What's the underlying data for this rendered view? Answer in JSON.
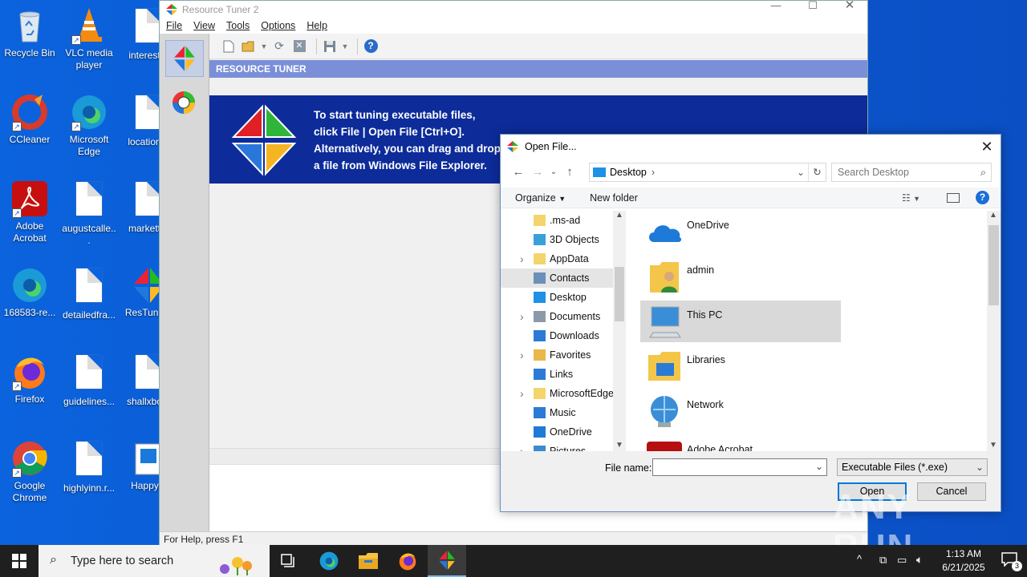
{
  "desktop": {
    "icons": [
      {
        "label": "Recycle Bin"
      },
      {
        "label": "VLC media player"
      },
      {
        "label": "interest..."
      },
      {
        "label": "CCleaner"
      },
      {
        "label": "Microsoft Edge"
      },
      {
        "label": "location..."
      },
      {
        "label": "Adobe Acrobat"
      },
      {
        "label": "augustcalle..."
      },
      {
        "label": "markett..."
      },
      {
        "label": "168583-re..."
      },
      {
        "label": "detailedfra..."
      },
      {
        "label": "ResTune..."
      },
      {
        "label": "Firefox"
      },
      {
        "label": "guidelines..."
      },
      {
        "label": "shallxbo..."
      },
      {
        "label": "Google Chrome"
      },
      {
        "label": "highlyinn.r..."
      },
      {
        "label": "Happy..."
      }
    ]
  },
  "app": {
    "title": "Resource Tuner 2",
    "menu": [
      "File",
      "View",
      "Tools",
      "Options",
      "Help"
    ],
    "banner_header": "RESOURCE TUNER",
    "banner_lines": [
      "To start tuning executable files,",
      "click File | Open File [Ctrl+O].",
      "Alternatively, you can drag and drop",
      "a file from Windows File Explorer."
    ],
    "status": "For Help, press F1"
  },
  "dialog": {
    "title": "Open File...",
    "address": "Desktop",
    "search_placeholder": "Search Desktop",
    "organize": "Organize",
    "new_folder": "New folder",
    "tree": [
      {
        "label": ".ms-ad",
        "expandable": false
      },
      {
        "label": "3D Objects",
        "expandable": false
      },
      {
        "label": "AppData",
        "expandable": true
      },
      {
        "label": "Contacts",
        "expandable": false
      },
      {
        "label": "Desktop",
        "expandable": false
      },
      {
        "label": "Documents",
        "expandable": true
      },
      {
        "label": "Downloads",
        "expandable": false
      },
      {
        "label": "Favorites",
        "expandable": true
      },
      {
        "label": "Links",
        "expandable": false
      },
      {
        "label": "MicrosoftEdge",
        "expandable": true
      },
      {
        "label": "Music",
        "expandable": false
      },
      {
        "label": "OneDrive",
        "expandable": false
      },
      {
        "label": "Pictures",
        "expandable": true
      }
    ],
    "files": [
      {
        "label": "OneDrive"
      },
      {
        "label": "admin"
      },
      {
        "label": "This PC"
      },
      {
        "label": "Libraries"
      },
      {
        "label": "Network"
      },
      {
        "label": "Adobe Acrobat"
      }
    ],
    "file_name_label": "File name:",
    "file_name_value": "",
    "file_type": "Executable Files (*.exe)",
    "open_label": "Open",
    "cancel_label": "Cancel"
  },
  "taskbar": {
    "search_placeholder": "Type here to search",
    "time": "1:13 AM",
    "date": "6/21/2025",
    "notification_count": "3"
  },
  "watermark": "ANY RUN"
}
